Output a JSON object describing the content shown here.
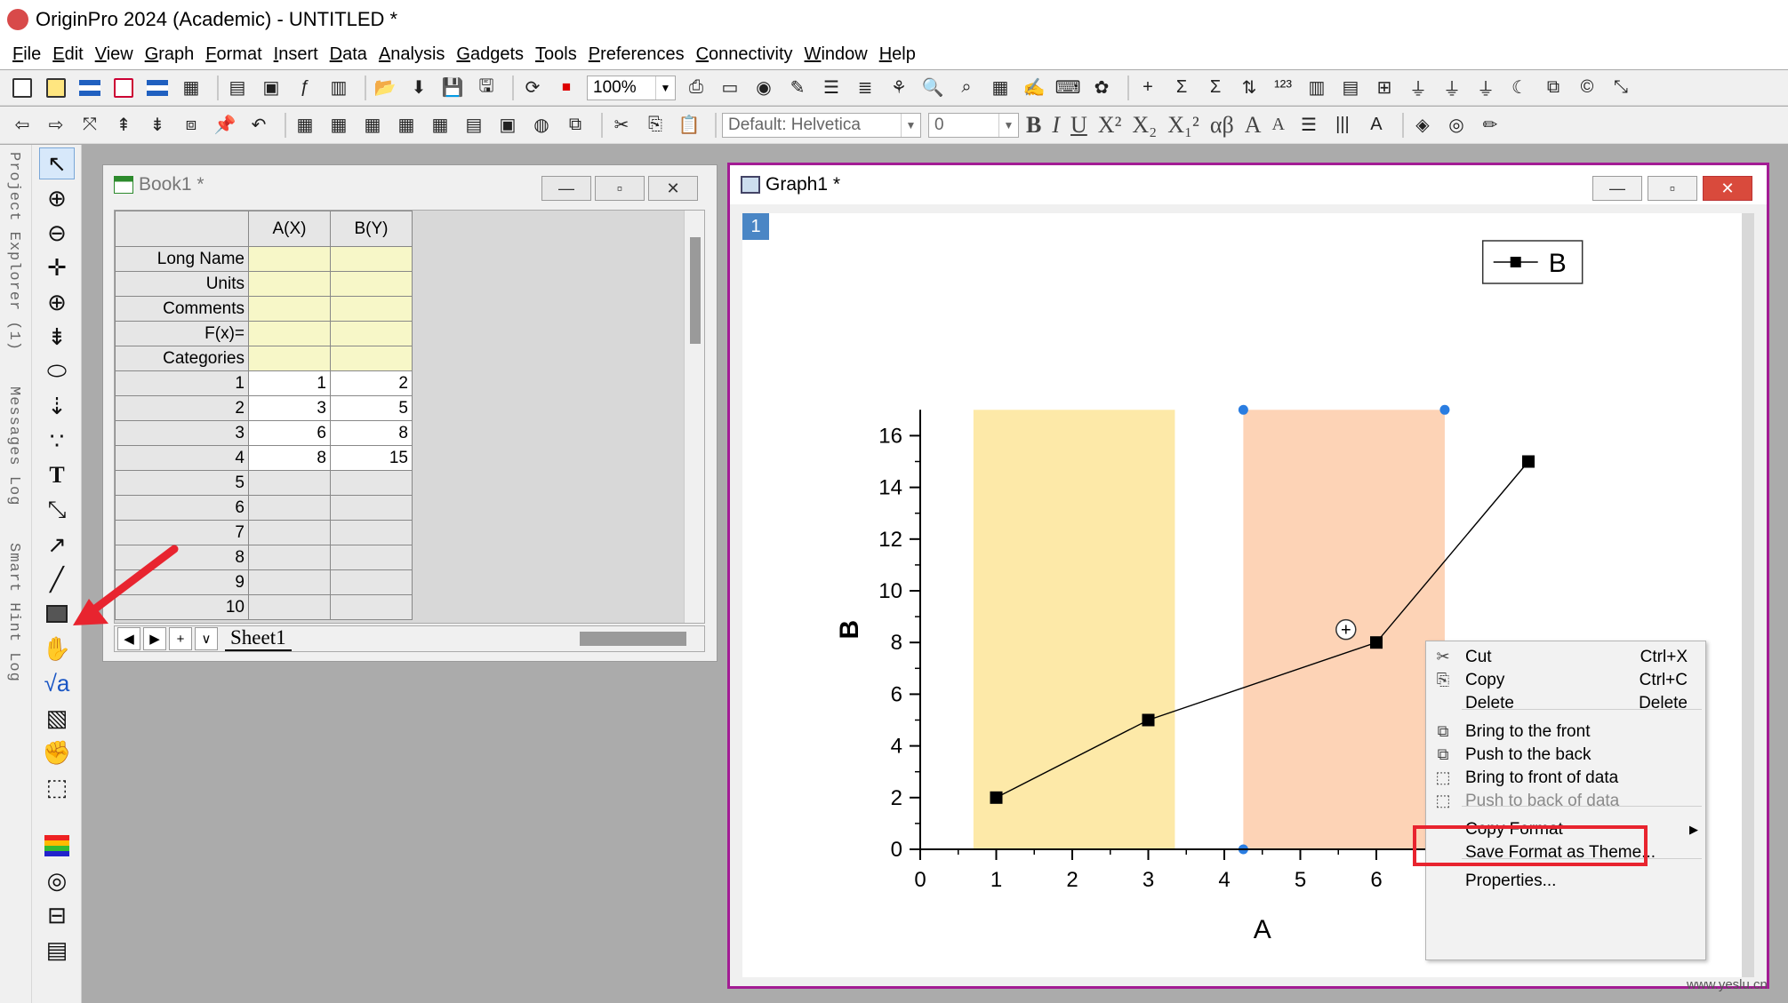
{
  "app": {
    "title": "OriginPro 2024 (Academic) - UNTITLED *"
  },
  "menu": [
    {
      "u": "F",
      "rest": "ile"
    },
    {
      "u": "E",
      "rest": "dit"
    },
    {
      "u": "V",
      "rest": "iew"
    },
    {
      "u": "G",
      "rest": "raph"
    },
    {
      "u": "F",
      "rest": "ormat"
    },
    {
      "u": "I",
      "rest": "nsert"
    },
    {
      "u": "D",
      "rest": "ata"
    },
    {
      "u": "A",
      "rest": "nalysis"
    },
    {
      "u": "G",
      "rest": "adgets"
    },
    {
      "u": "T",
      "rest": "ools"
    },
    {
      "u": "P",
      "rest": "references"
    },
    {
      "u": "C",
      "rest": "onnectivity"
    },
    {
      "u": "W",
      "rest": "indow"
    },
    {
      "u": "H",
      "rest": "elp"
    }
  ],
  "toolbar": {
    "zoom": "100%",
    "font": "Default: Helvetica",
    "font_size": "0",
    "format_glyphs": [
      "B",
      "I",
      "U",
      "X²",
      "X₂",
      "X₁²",
      "αβ",
      "A",
      "A"
    ]
  },
  "side_tabs": [
    "Project Explorer (1)",
    "Messages Log",
    "Smart Hint Log"
  ],
  "book": {
    "title": "Book1 *",
    "columns": [
      "A(X)",
      "B(Y)"
    ],
    "meta_rows": [
      "Long Name",
      "Units",
      "Comments",
      "F(x)=",
      "Categories"
    ],
    "rows": [
      {
        "n": "1",
        "a": "1",
        "b": "2"
      },
      {
        "n": "2",
        "a": "3",
        "b": "5"
      },
      {
        "n": "3",
        "a": "6",
        "b": "8"
      },
      {
        "n": "4",
        "a": "8",
        "b": "15"
      },
      {
        "n": "5",
        "a": "",
        "b": ""
      },
      {
        "n": "6",
        "a": "",
        "b": ""
      },
      {
        "n": "7",
        "a": "",
        "b": ""
      },
      {
        "n": "8",
        "a": "",
        "b": ""
      },
      {
        "n": "9",
        "a": "",
        "b": ""
      },
      {
        "n": "10",
        "a": "",
        "b": ""
      }
    ],
    "sheet_tab": "Sheet1"
  },
  "graph": {
    "title": "Graph1 *",
    "layer": "1",
    "plus_glyph": "+",
    "accent": "#a31c94"
  },
  "chart_data": {
    "type": "line",
    "x": [
      1,
      3,
      6,
      8
    ],
    "y": [
      2,
      5,
      8,
      15
    ],
    "xlabel": "A",
    "ylabel": "B",
    "xlim": [
      0,
      8
    ],
    "ylim": [
      0,
      17
    ],
    "xticks": [
      0,
      1,
      2,
      3,
      4,
      5,
      6
    ],
    "yticks": [
      0,
      2,
      4,
      6,
      8,
      10,
      12,
      14,
      16
    ],
    "legend": "B",
    "legend_position": "top-right",
    "marker": "square",
    "bands": [
      {
        "x_from": 0.7,
        "x_to": 3.35,
        "color": "#fde9a8"
      },
      {
        "x_from": 4.25,
        "x_to": 6.9,
        "color": "#fdd3b6"
      }
    ]
  },
  "context_menu": {
    "items": [
      {
        "label": "Cut",
        "shortcut": "Ctrl+X",
        "icon": "scissors-icon"
      },
      {
        "label": "Copy",
        "shortcut": "Ctrl+C",
        "icon": "copy-icon"
      },
      {
        "label": "Delete",
        "shortcut": "Delete",
        "icon": ""
      },
      {
        "label": "Bring to the front",
        "shortcut": "",
        "icon": "bring-front-icon"
      },
      {
        "label": "Push to the back",
        "shortcut": "",
        "icon": "push-back-icon"
      },
      {
        "label": "Bring to front of data",
        "shortcut": "",
        "icon": "bring-front-data-icon"
      },
      {
        "label": "Push to back of data",
        "shortcut": "",
        "icon": "push-back-data-icon",
        "disabled": true
      },
      {
        "label": "Copy Format",
        "shortcut": "",
        "icon": "",
        "submenu": true
      },
      {
        "label": "Save Format as Theme...",
        "shortcut": "",
        "icon": ""
      },
      {
        "label": "Properties...",
        "shortcut": "",
        "icon": ""
      }
    ],
    "highlight_color": "#e8242f"
  },
  "watermark": "www.yeslu.cn"
}
